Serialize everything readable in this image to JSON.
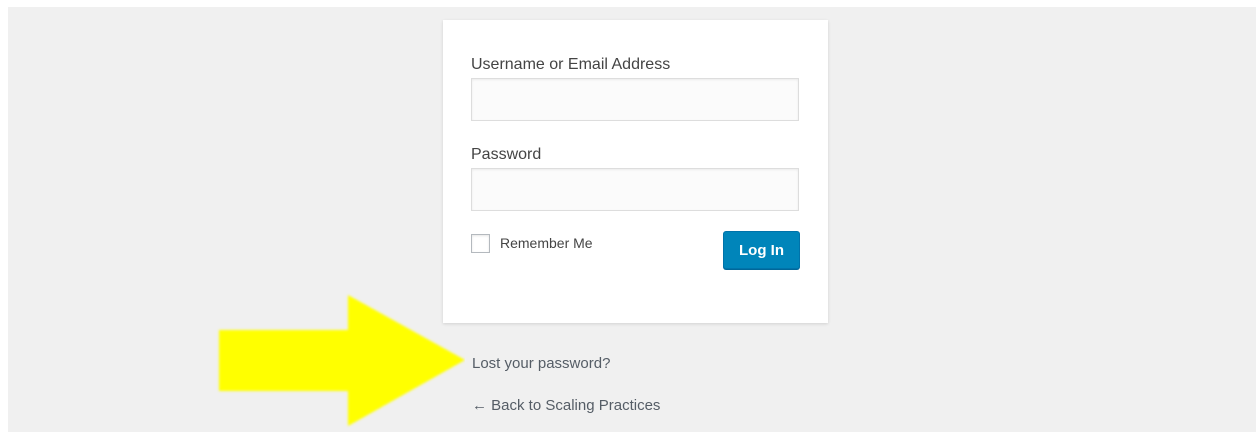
{
  "login_form": {
    "username_label": "Username or Email Address",
    "username_value": "",
    "password_label": "Password",
    "password_value": "",
    "remember_label": "Remember Me",
    "remember_checked": false,
    "submit_label": "Log In"
  },
  "links": {
    "lost_password": "Lost your password?",
    "back_to_site": "← Back to Scaling Practices"
  },
  "annotation": {
    "arrow_color": "#ffff00",
    "arrow_direction": "right"
  },
  "colors": {
    "background": "#f0f0f0",
    "button": "#0085ba",
    "link": "#555d66"
  }
}
